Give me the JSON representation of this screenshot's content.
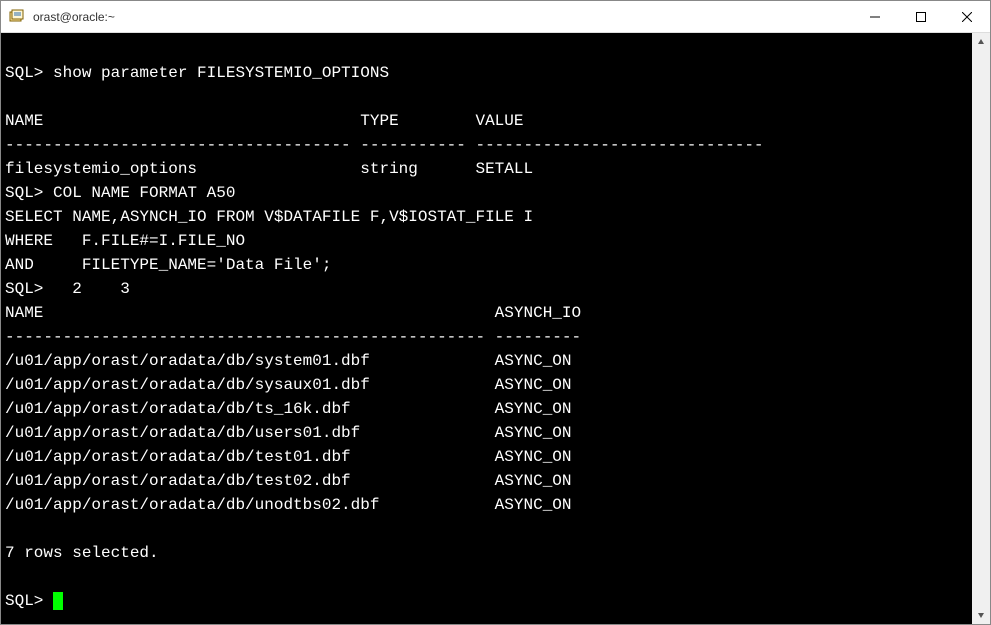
{
  "window": {
    "title": "orast@oracle:~"
  },
  "terminal": {
    "prompt": "SQL>",
    "cmd1": "show parameter FILESYSTEMIO_OPTIONS",
    "hdr_name": "NAME",
    "hdr_type": "TYPE",
    "hdr_value": "VALUE",
    "dash1a": "------------------------------------",
    "dash1b": "-----------",
    "dash1c": "------------------------------",
    "param_name": "filesystemio_options",
    "param_type": "string",
    "param_value": "SETALL",
    "cmd2": "COL NAME FORMAT A50",
    "cmd3": "SELECT NAME,ASYNCH_IO FROM V$DATAFILE F,V$IOSTAT_FILE I",
    "cmd4": "WHERE   F.FILE#=I.FILE_NO",
    "cmd5": "AND     FILETYPE_NAME='Data File';",
    "cont_prompt": "SQL>   2    3",
    "hdr2_name": "NAME",
    "hdr2_async": "ASYNCH_IO",
    "dash2a": "--------------------------------------------------",
    "dash2b": "---------",
    "rows": [
      {
        "name": "/u01/app/orast/oradata/db/system01.dbf",
        "async": "ASYNC_ON"
      },
      {
        "name": "/u01/app/orast/oradata/db/sysaux01.dbf",
        "async": "ASYNC_ON"
      },
      {
        "name": "/u01/app/orast/oradata/db/ts_16k.dbf",
        "async": "ASYNC_ON"
      },
      {
        "name": "/u01/app/orast/oradata/db/users01.dbf",
        "async": "ASYNC_ON"
      },
      {
        "name": "/u01/app/orast/oradata/db/test01.dbf",
        "async": "ASYNC_ON"
      },
      {
        "name": "/u01/app/orast/oradata/db/test02.dbf",
        "async": "ASYNC_ON"
      },
      {
        "name": "/u01/app/orast/oradata/db/unodtbs02.dbf",
        "async": "ASYNC_ON"
      }
    ],
    "summary": "7 rows selected."
  }
}
